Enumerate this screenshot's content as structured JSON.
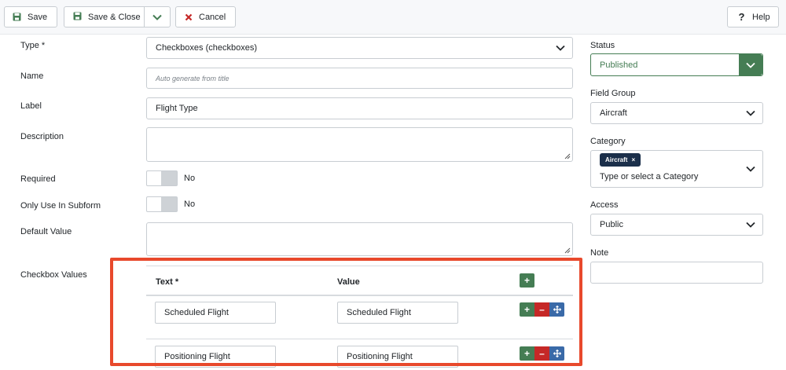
{
  "toolbar": {
    "save": "Save",
    "save_close": "Save & Close",
    "cancel": "Cancel",
    "help": "Help"
  },
  "form": {
    "type_label": "Type *",
    "type_value": "Checkboxes (checkboxes)",
    "name_label": "Name",
    "name_placeholder": "Auto generate from title",
    "label_label": "Label",
    "label_value": "Flight Type",
    "description_label": "Description",
    "description_value": "",
    "required_label": "Required",
    "required_value": "No",
    "subform_label": "Only Use In Subform",
    "subform_value": "No",
    "default_label": "Default Value",
    "default_value": "",
    "checkbox_values_label": "Checkbox Values"
  },
  "options_table": {
    "headers": {
      "text": "Text *",
      "value": "Value"
    },
    "rows": [
      {
        "text": "Scheduled Flight",
        "value": "Scheduled Flight"
      },
      {
        "text": "Positioning Flight",
        "value": "Positioning Flight"
      }
    ]
  },
  "sidebar": {
    "status_label": "Status",
    "status_value": "Published",
    "field_group_label": "Field Group",
    "field_group_value": "Aircraft",
    "category_label": "Category",
    "category_tag": "Aircraft",
    "category_placeholder": "Type or select a Category",
    "access_label": "Access",
    "access_value": "Public",
    "note_label": "Note",
    "note_value": ""
  },
  "colors": {
    "success": "#457d54",
    "danger": "#c52827",
    "primary": "#3a6aa8",
    "highlight": "#e8492c",
    "tag": "#1b2f4a"
  },
  "icons": {
    "save": "floppy-disk-icon",
    "cancel": "x-icon",
    "help": "question-icon",
    "add": "plus-icon",
    "remove": "minus-icon",
    "move": "arrows-move-icon",
    "dropdown": "chevron-down-icon"
  }
}
